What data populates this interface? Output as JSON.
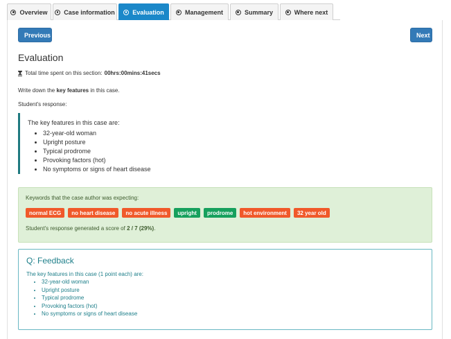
{
  "tabs": [
    {
      "label": "Overview",
      "icon": "circle-dot-icon",
      "active": false
    },
    {
      "label": "Case information",
      "icon": "circle-dot-icon",
      "active": false
    },
    {
      "label": "Evaluation",
      "icon": "circle-dot-icon",
      "active": true
    },
    {
      "label": "Management",
      "icon": "circle-dot-icon",
      "active": false
    },
    {
      "label": "Summary",
      "icon": "circle-dot-icon",
      "active": false
    },
    {
      "label": "Where next",
      "icon": "circle-dot-icon",
      "active": false
    }
  ],
  "nav": {
    "previous_label": "Previous",
    "next_label": "Next"
  },
  "page": {
    "title": "Evaluation",
    "timer_label": "Total time spent on this section:",
    "timer_value": "00hrs:00mins:41secs",
    "instruction_pre": "Write down the ",
    "instruction_bold": "key features",
    "instruction_post": " in this case.",
    "response_label": "Student's response:"
  },
  "response": {
    "intro": "The key features in this case are:",
    "items": [
      "32-year-old woman",
      "Upright posture",
      "Typical prodrome",
      "Provoking factors (hot)",
      "No symptoms or signs of heart disease"
    ]
  },
  "keywords": {
    "heading": "Keywords that the case author was expecting:",
    "tags": [
      {
        "label": "normal ECG",
        "matched": false
      },
      {
        "label": "no heart disease",
        "matched": false
      },
      {
        "label": "no acute illness",
        "matched": false
      },
      {
        "label": "upright",
        "matched": true
      },
      {
        "label": "prodrome",
        "matched": true
      },
      {
        "label": "hot environment",
        "matched": false
      },
      {
        "label": "32 year old",
        "matched": false
      }
    ],
    "score_pre": "Student's response generated a score of ",
    "score_value": "2 / 7 (29%)",
    "score_post": ".",
    "colors": {
      "matched": "#16a05d",
      "unmatched": "#f0592a"
    }
  },
  "feedback": {
    "title": "Q: Feedback",
    "intro": "The key features in this case (1 point each) are:",
    "items": [
      "32-year-old woman",
      "Upright posture",
      "Typical prodrome",
      "Provoking factors (hot)",
      "No symptoms or signs of heart disease"
    ]
  }
}
